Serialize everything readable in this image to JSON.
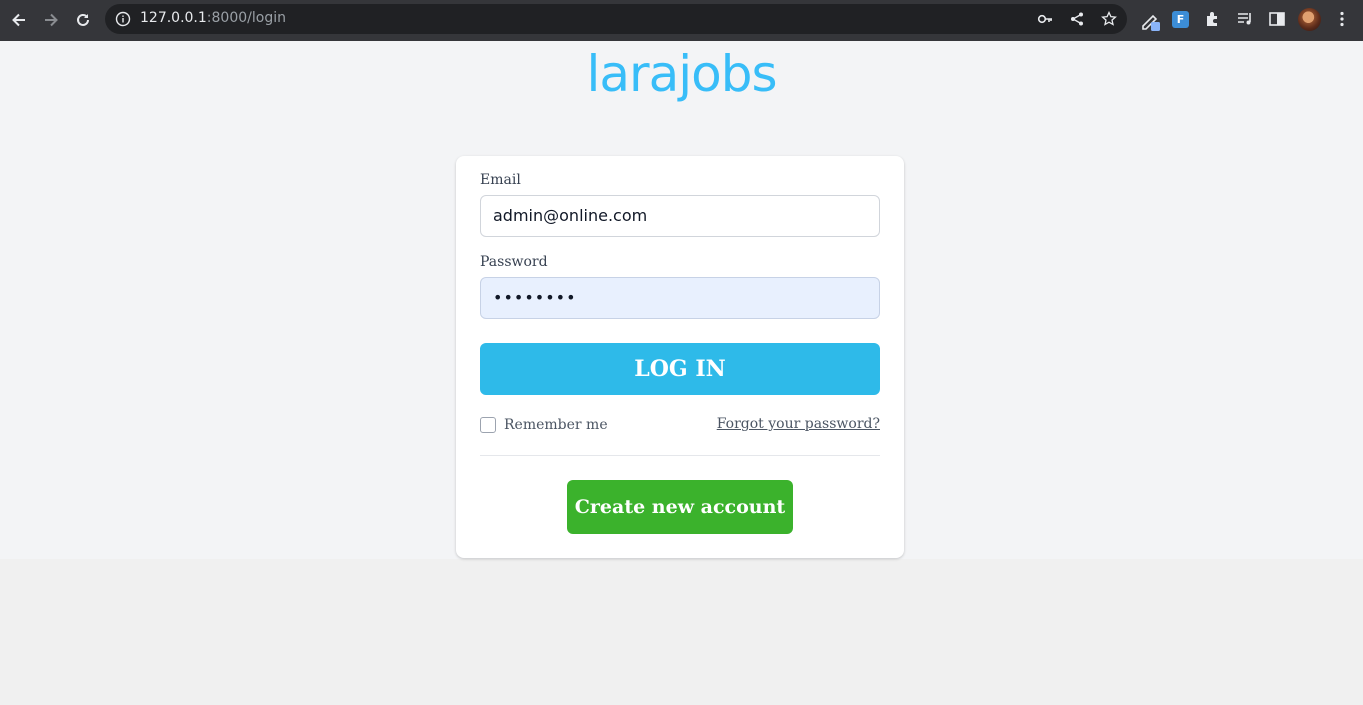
{
  "browser": {
    "url_host": "127.0.0.1",
    "url_rest": ":8000/login",
    "icons": [
      "back-icon",
      "forward-icon",
      "reload-icon",
      "info-icon",
      "key-icon",
      "share-icon",
      "star-icon",
      "pen-icon",
      "extension-f-icon",
      "puzzle-icon",
      "media-icon",
      "sidepanel-icon",
      "avatar",
      "menu-icon"
    ],
    "ext_label": "F"
  },
  "brand": {
    "logo_text": "larajobs",
    "color": "#38bdf8"
  },
  "form": {
    "email_label": "Email",
    "email_value": "admin@online.com",
    "password_label": "Password",
    "password_value": "••••••••",
    "login_label": "LOG IN",
    "remember_label": "Remember me",
    "remember_checked": false,
    "forgot_label": "Forgot your password?",
    "create_label": "Create new account"
  },
  "colors": {
    "login_button": "#2ebae9",
    "create_button": "#3bb22c"
  }
}
